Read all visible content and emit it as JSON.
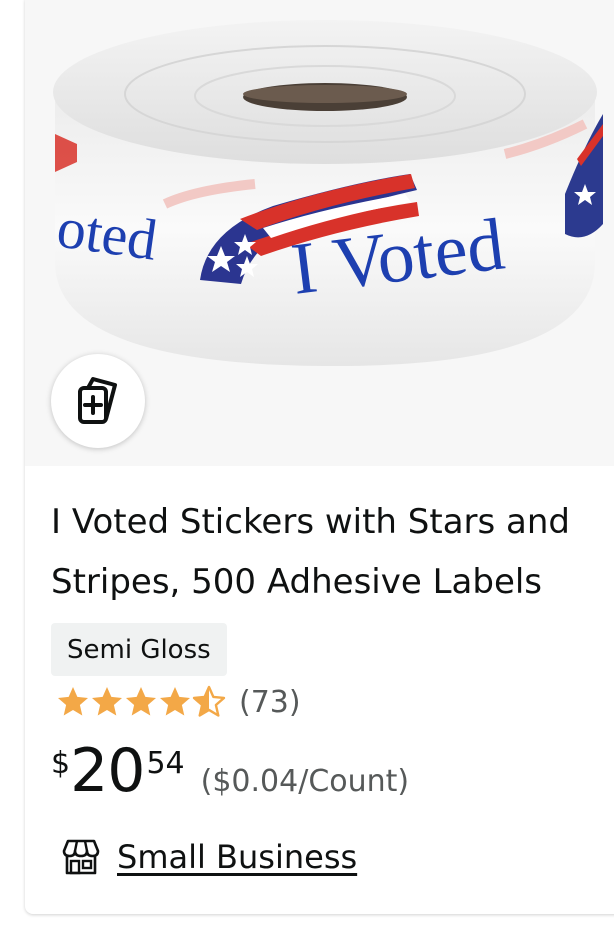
{
  "product": {
    "title": "I Voted Stickers with Stars and Stripes, 500 Adhesive Labels",
    "image_text": "I Voted",
    "variant": "Semi Gloss",
    "rating": 4.5,
    "rating_max": 5,
    "review_count": "(73)",
    "price": {
      "symbol": "$",
      "whole": "20",
      "fraction": "54"
    },
    "unit_price": "($0.04/Count)",
    "badge": {
      "icon": "storefront-icon",
      "label": "Small Business"
    },
    "compare_icon": "compare-cards-icon"
  },
  "colors": {
    "star": "#f3a847",
    "text": "#0f1111",
    "secondary_text": "#565959",
    "badge_bg": "#f0f2f2",
    "image_bg": "#f7f7f7"
  }
}
